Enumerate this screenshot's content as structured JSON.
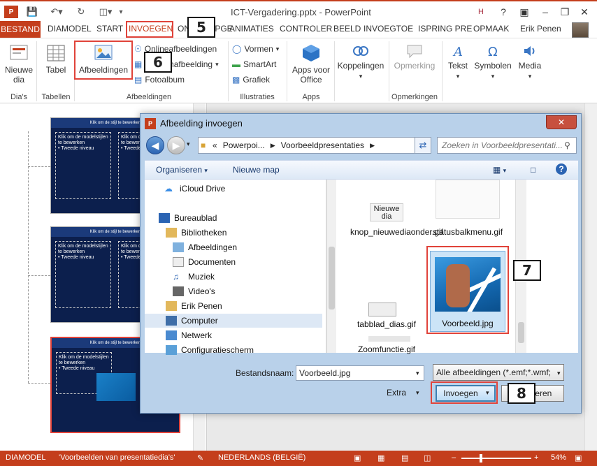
{
  "window": {
    "title": "ICT-Vergadering.pptx - PowerPoint",
    "help": "?",
    "search_letter": "H"
  },
  "tabs": [
    "BESTAND",
    "DIAMODEL",
    "START",
    "INVOEGEN",
    "ONTWERPGE",
    "ANIMATIES",
    "CONTROLER",
    "BEELD",
    "INVOEGTOE",
    "ISPRING PRE",
    "OPMAAK"
  ],
  "user": "Erik Penen",
  "ribbon": {
    "new_slide": "Nieuwe dia",
    "table": "Tabel",
    "images": "Afbeeldingen",
    "online_images": "Onlineafbeeldingen",
    "screenshot": "Schermafbeelding",
    "photo_album": "Fotoalbum",
    "shapes": "Vormen",
    "smartart": "SmartArt",
    "chart": "Grafiek",
    "apps": "Apps voor Office",
    "links": "Koppelingen",
    "comment": "Opmerking",
    "text": "Tekst",
    "symbols": "Symbolen",
    "media": "Media",
    "groups": {
      "slides": "Dia's",
      "tables": "Tabellen",
      "images": "Afbeeldingen",
      "illustrations": "Illustraties",
      "apps": "Apps",
      "comments": "Opmerkingen"
    }
  },
  "callouts": [
    "5",
    "6",
    "7",
    "8"
  ],
  "slide_text": {
    "title": "Klik om de stijl te bewerken",
    "body": "Klik om de modelstijlen te bewerken",
    "level2": "Tweede niveau"
  },
  "dialog": {
    "title": "Afbeelding invoegen",
    "path": [
      "Powerpoi...",
      "Voorbeeldpresentaties"
    ],
    "search_placeholder": "Zoeken in Voorbeeldpresentati...",
    "organize": "Organiseren",
    "new_folder": "Nieuwe map",
    "tree": [
      "iCloud Drive",
      "Bureaublad",
      "Bibliotheken",
      "Afbeeldingen",
      "Documenten",
      "Muziek",
      "Video's",
      "Erik Penen",
      "Computer",
      "Netwerk",
      "Configuratiescherm"
    ],
    "files": {
      "f1": "knop_nieuwediaonder.gif",
      "f1_thumb": "Nieuwe dia",
      "f2": "statusbalkmenu.gif",
      "f3": "tabblad_dias.gif",
      "f4": "Voorbeeld.jpg",
      "f5": "Zoomfunctie.gif"
    },
    "filename_label": "Bestandsnaam:",
    "filename": "Voorbeeld.jpg",
    "filter": "Alle afbeeldingen (*.emf;*.wmf;",
    "extra": "Extra",
    "insert": "Invoegen",
    "cancel": "Annuleren"
  },
  "status": {
    "view": "DIAMODEL",
    "theme": "'Voorbeelden van presentatiedia's'",
    "language": "NEDERLANDS (BELGIË)",
    "zoom": "54%"
  },
  "colors": {
    "accent": "#c43e1c",
    "highlight": "#e0433a"
  }
}
